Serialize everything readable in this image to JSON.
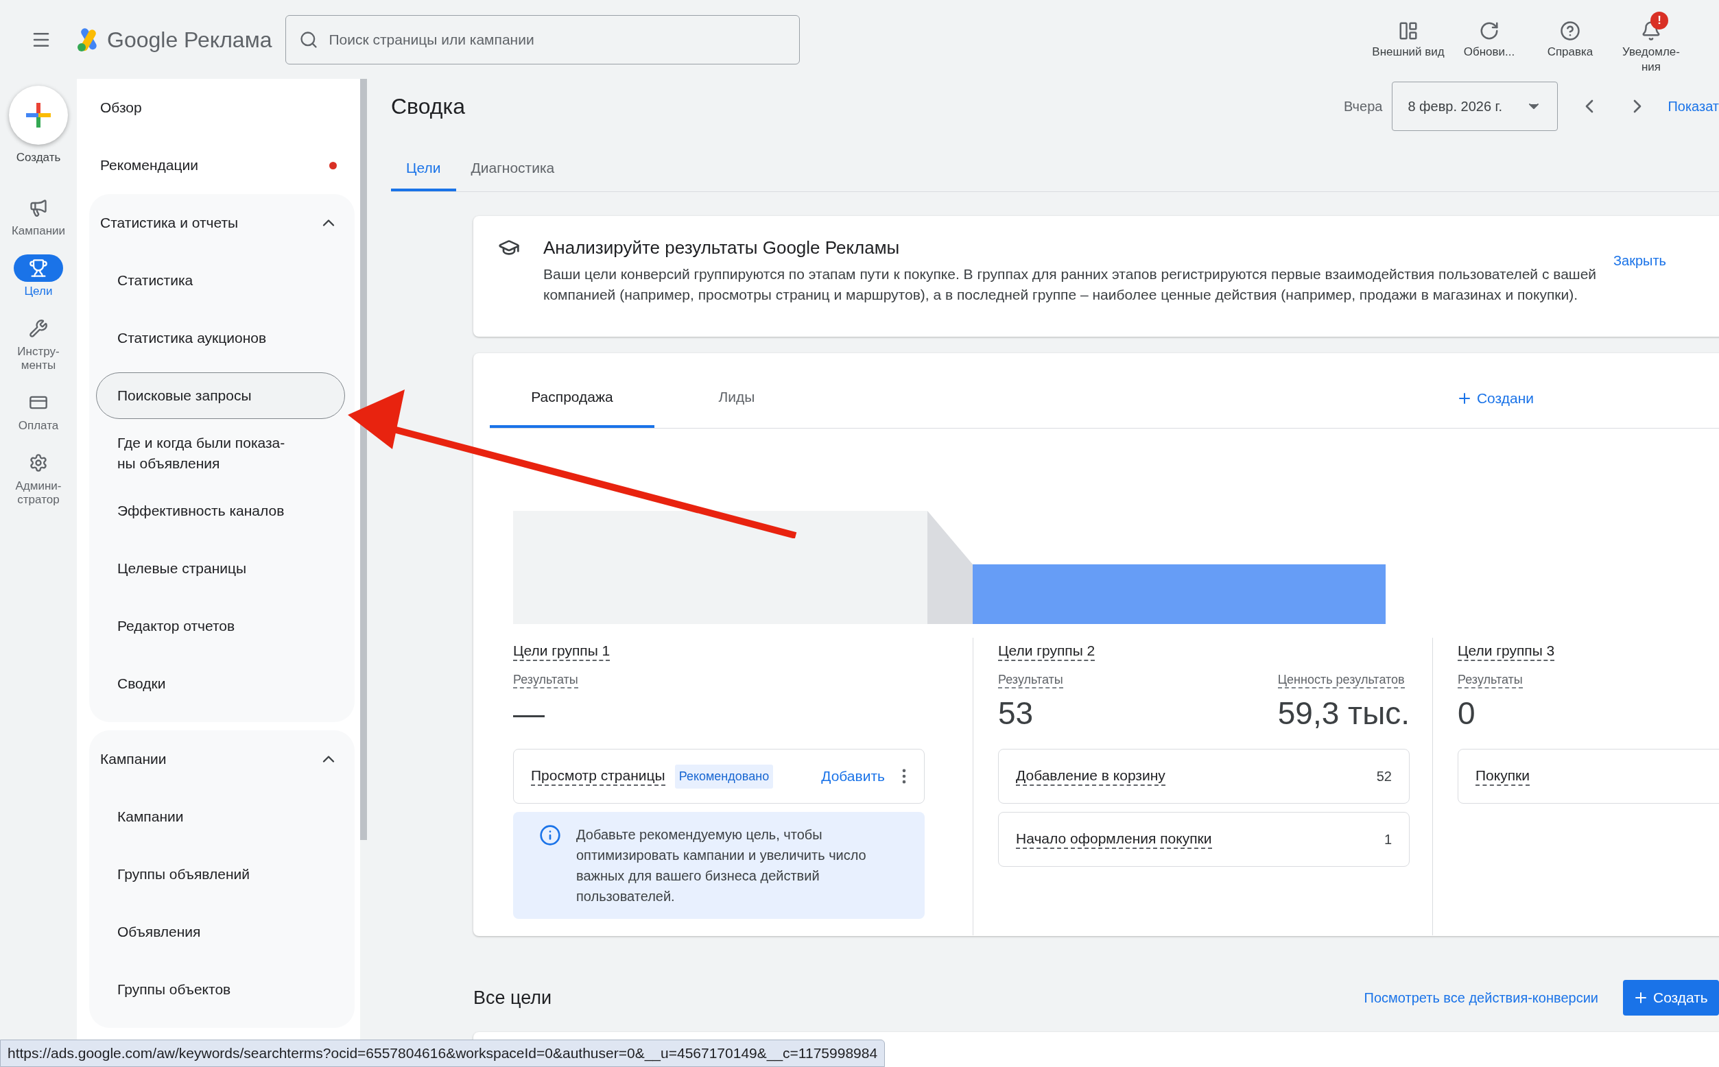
{
  "header": {
    "logo_brand": "Google",
    "logo_product": "Реклама",
    "search": {
      "placeholder": "Поиск страницы или кампании"
    },
    "actions": [
      {
        "kind": "layout",
        "label": "Внешний вид"
      },
      {
        "kind": "refresh",
        "label": "Обнови..."
      },
      {
        "kind": "help",
        "label": "Справка"
      },
      {
        "kind": "bell",
        "label": "Уведомле-\nния",
        "badge": "!"
      }
    ]
  },
  "rail": {
    "create": "Создать",
    "items": [
      {
        "kind": "megaphone",
        "label": "Кампании",
        "selected": false
      },
      {
        "kind": "trophy",
        "label": "Цели",
        "selected": true
      },
      {
        "kind": "tools",
        "label": "Инстру-\nменты",
        "selected": false
      },
      {
        "kind": "card",
        "label": "Оплата",
        "selected": false
      },
      {
        "kind": "gear",
        "label": "Админи-\nстратор",
        "selected": false
      }
    ]
  },
  "sidebar": {
    "items": [
      {
        "kind": "link",
        "label": "Обзор",
        "dot": false
      },
      {
        "kind": "link",
        "label": "Рекомендации",
        "dot": true
      },
      {
        "kind": "group",
        "label": "Статистика и отчеты",
        "expanded": true,
        "children": [
          {
            "label": "Статистика",
            "selected": false
          },
          {
            "label": "Статистика аукционов",
            "selected": false
          },
          {
            "label": "Поисковые запросы",
            "selected": true
          },
          {
            "label": "Где и когда были показа-\nны объявления",
            "selected": false
          },
          {
            "label": "Эффективность каналов",
            "selected": false
          },
          {
            "label": "Целевые страницы",
            "selected": false
          },
          {
            "label": "Редактор отчетов",
            "selected": false
          },
          {
            "label": "Сводки",
            "selected": false
          }
        ]
      },
      {
        "kind": "group",
        "label": "Кампании",
        "expanded": true,
        "children": [
          {
            "label": "Кампании",
            "selected": false
          },
          {
            "label": "Группы объявлений",
            "selected": false
          },
          {
            "label": "Объявления",
            "selected": false
          },
          {
            "label": "Группы объектов",
            "selected": false
          }
        ]
      }
    ]
  },
  "page": {
    "title": "Сводка",
    "date_label": "Вчера",
    "date": "8 февр. 2026 г.",
    "show": "Показат",
    "tabs": [
      {
        "label": "Цели",
        "selected": true
      },
      {
        "label": "Диагностика",
        "selected": false
      }
    ]
  },
  "info_card": {
    "title": "Анализируйте результаты Google Рекламы",
    "text": "Ваши цели конверсий группируются по этапам пути к покупке. В группах для ранних этапов регистрируются первые взаимодействия пользователей с вашей компанией (например, просмотры страниц и маршрутов), а в последней группе – наиболее ценные действия (например, продажи в магазинах и покупки).",
    "close": "Закрыть"
  },
  "goals_card": {
    "tabs": [
      {
        "label": "Распродажа",
        "selected": true
      },
      {
        "label": "Лиды",
        "selected": false
      }
    ],
    "create": "Создани",
    "groups": [
      {
        "title": "Цели группы 1",
        "metrics": [
          {
            "label": "Результаты",
            "value": "—"
          }
        ],
        "goals": [
          {
            "kind": "recommended",
            "name": "Просмотр страницы",
            "badge": "Рекомендовано",
            "action": "Добавить"
          }
        ],
        "note": "Добавьте рекомендуемую цель, чтобы оптимизировать кампании и увеличить число важных для вашего бизнеса действий пользователей."
      },
      {
        "title": "Цели группы 2",
        "metrics": [
          {
            "label": "Результаты",
            "value": "53"
          },
          {
            "label": "Ценность результатов",
            "value": "59,3 тыс."
          }
        ],
        "goals": [
          {
            "kind": "count",
            "name": "Добавление в корзину",
            "count": "52"
          },
          {
            "kind": "count",
            "name": "Начало оформления покупки",
            "count": "1"
          }
        ]
      },
      {
        "title": "Цели группы 3",
        "metrics": [
          {
            "label": "Результаты",
            "value": "0"
          }
        ],
        "goals": [
          {
            "kind": "plain",
            "name": "Покупки"
          }
        ]
      }
    ]
  },
  "all_goals": {
    "title": "Все цели",
    "link": "Посмотреть все действия-конверсии",
    "create": "Создать"
  },
  "status_bar": {
    "url": "https://ads.google.com/aw/keywords/searchterms?ocid=6557804616&workspaceId=0&authuser=0&__u=4567170149&__c=1175998984"
  }
}
